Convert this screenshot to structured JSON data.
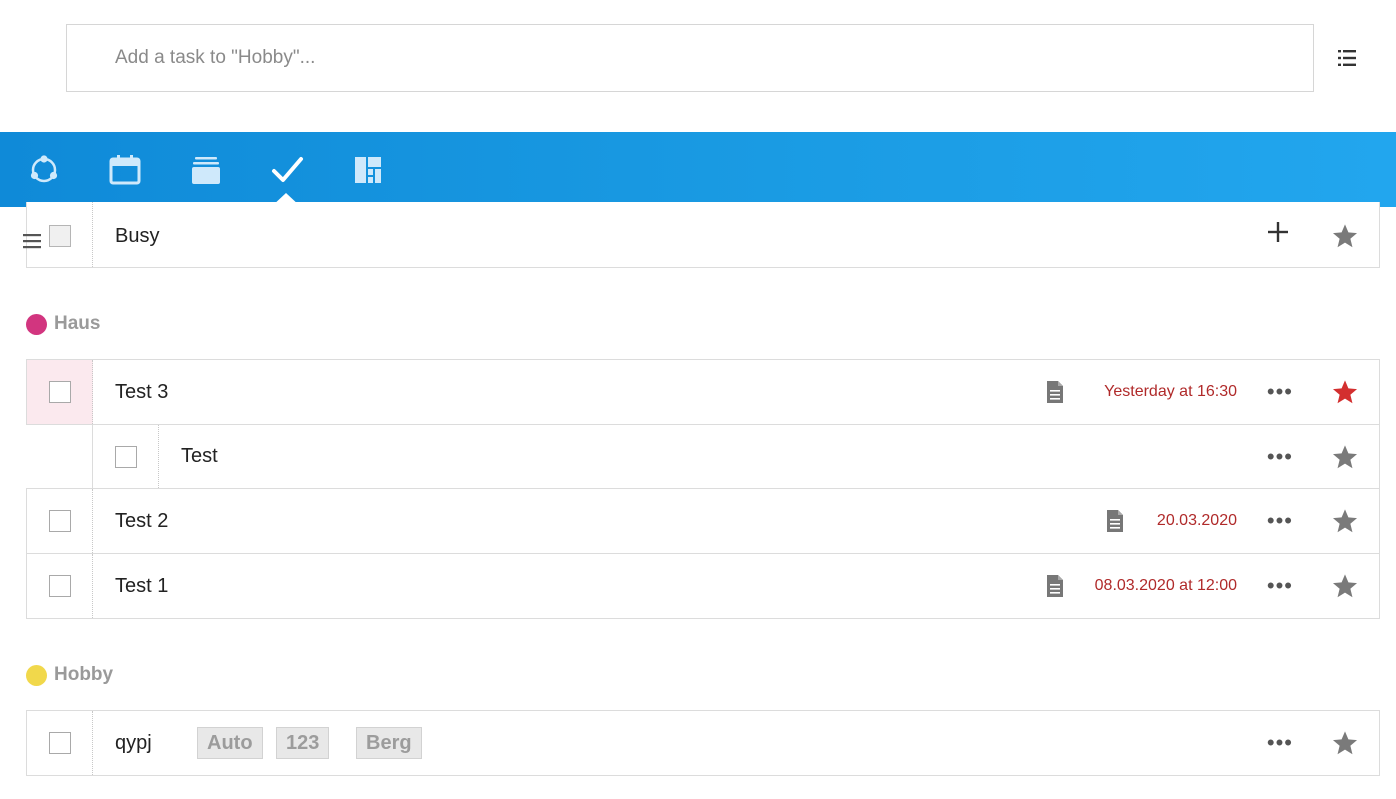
{
  "add_task": {
    "placeholder": "Add a task to \"Hobby\"..."
  },
  "navbar": {
    "tabs": [
      {
        "icon": "cycle-icon"
      },
      {
        "icon": "calendar-icon"
      },
      {
        "icon": "stack-icon"
      },
      {
        "icon": "check-icon",
        "active": true
      },
      {
        "icon": "dashboard-icon"
      }
    ]
  },
  "busy_row": {
    "title": "Busy"
  },
  "groups": [
    {
      "name": "Haus",
      "color": "#d2357f",
      "tasks": [
        {
          "title": "Test 3",
          "date": "Yesterday at 16:30",
          "starred": true,
          "has_note": true
        },
        {
          "title": "Test",
          "subtask": true
        },
        {
          "title": "Test 2",
          "date": "20.03.2020",
          "has_note": true
        },
        {
          "title": "Test 1",
          "date": "08.03.2020 at 12:00",
          "has_note": true
        }
      ]
    },
    {
      "name": "Hobby",
      "color": "#f1d84b",
      "tasks": [
        {
          "title": "qypj",
          "tags": [
            "Auto",
            "123",
            "Berg"
          ]
        }
      ]
    }
  ],
  "more_label": "•••",
  "colors": {
    "accent": "#1a9be3",
    "date": "#b02a2a",
    "star_active": "#d32f2f",
    "star_inactive": "#7a7a7a"
  }
}
